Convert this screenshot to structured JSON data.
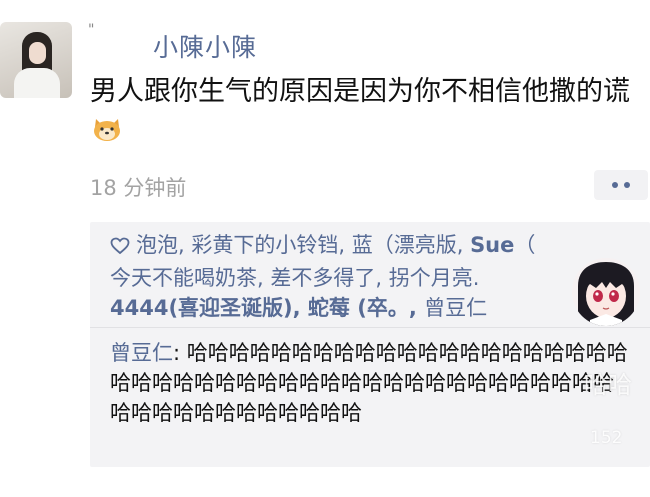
{
  "post": {
    "mark": "\"",
    "nickname": "小陳小陳",
    "text": "男人跟你生气的原因是因为你不相信他撒的谎",
    "emoji": "doge-emoji",
    "time": "18 分钟前",
    "more_icon": "more-dots-icon"
  },
  "likes": {
    "icon": "heart-outline-icon",
    "line1_names": "泡泡, 彩黄下的小铃铛, 蓝（漂亮版, ",
    "line1_bold": "Sue",
    "line1_tail": "（",
    "line2": "今天不能喝奶茶, 差不多得了, 拐个月亮.",
    "line3_bold": "4444(喜迎圣诞版), 蛇莓 (卒。, ",
    "line3_tail": "曾豆仁"
  },
  "comment": {
    "author": "曾豆仁",
    "separator": ": ",
    "text": "哈哈哈哈哈哈哈哈哈哈哈哈哈哈哈哈哈哈哈哈哈哈哈哈哈哈哈哈哈哈哈哈哈哈哈哈哈哈哈哈哈哈哈哈哈哈哈哈哈哈哈哈哈哈哈哈哈"
  },
  "watermark": {
    "text": "哈哈",
    "number": "152"
  },
  "colors": {
    "link": "#576b95",
    "panel": "#f3f3f5",
    "time": "#a3a3a3"
  }
}
